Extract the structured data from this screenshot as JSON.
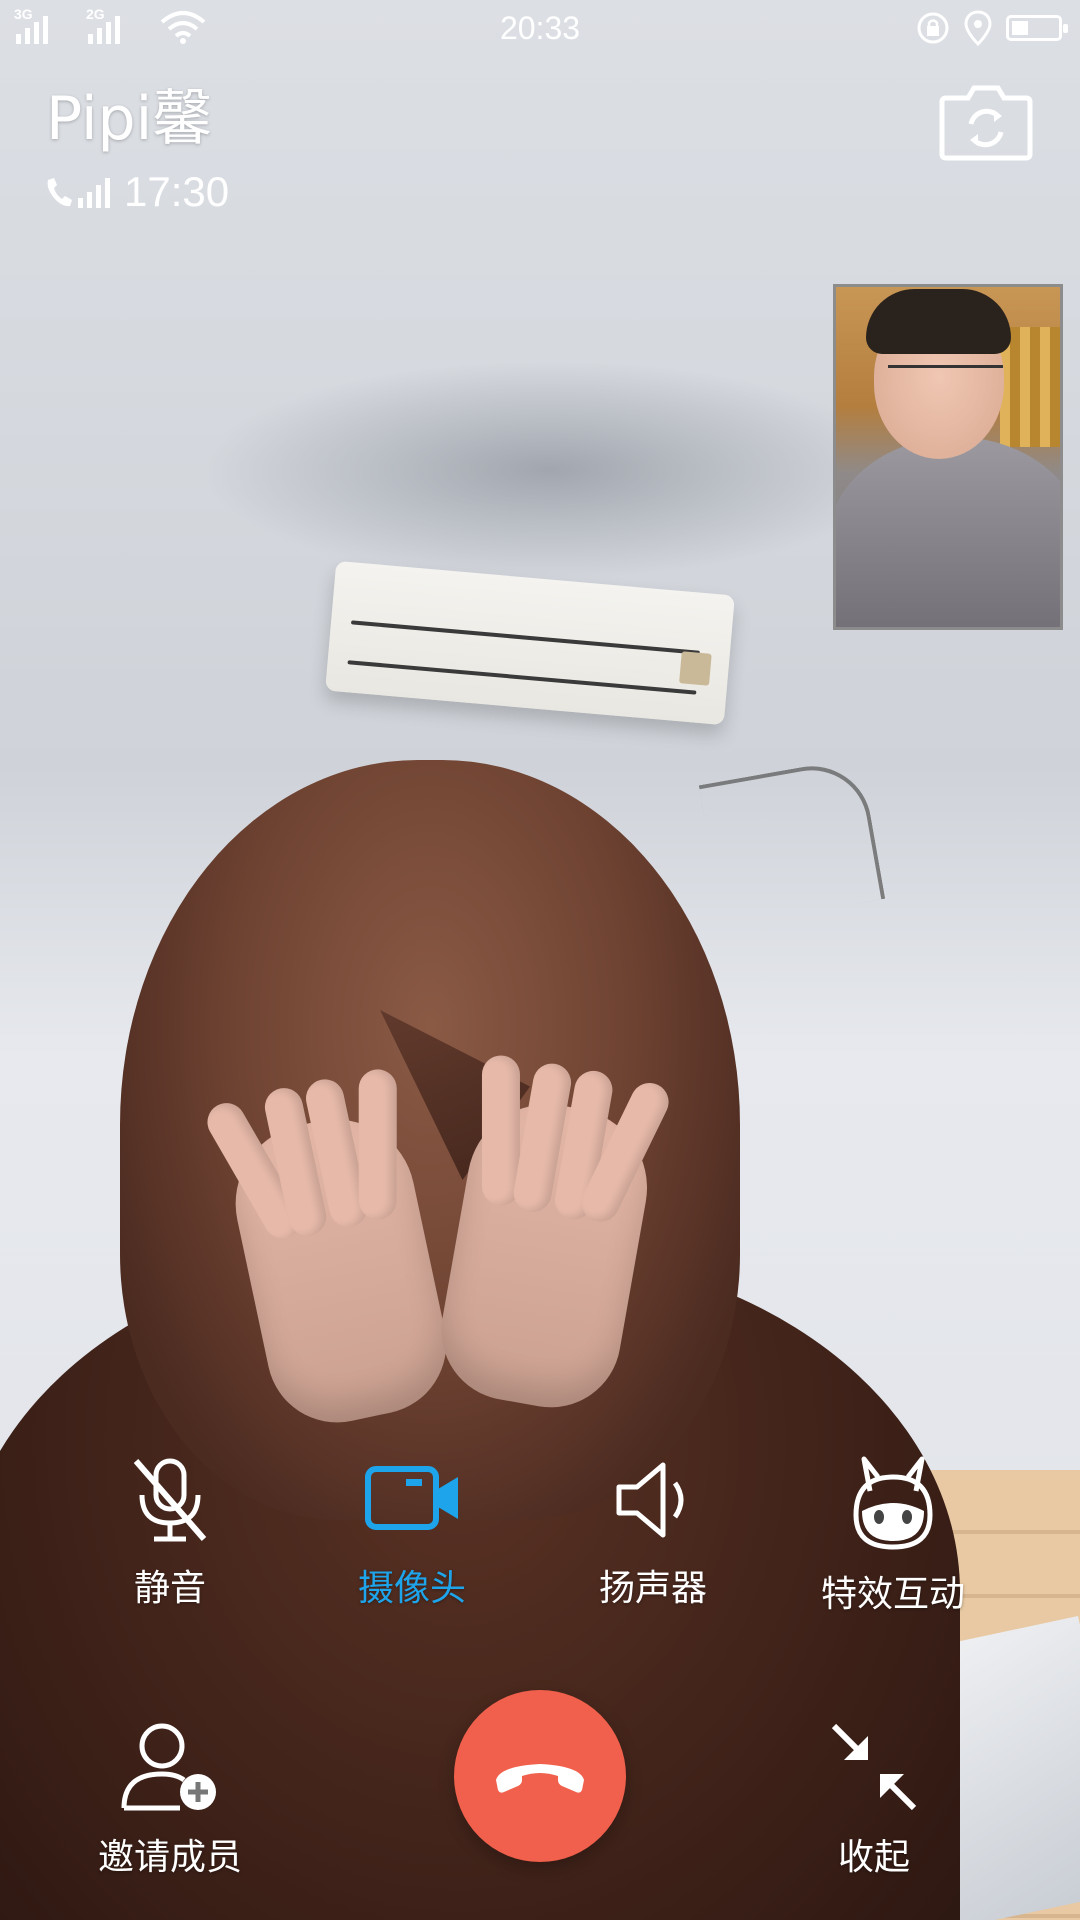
{
  "status_bar": {
    "network_1": "3G",
    "network_2": "2G",
    "time": "20:33"
  },
  "call": {
    "caller_name": "Pipi馨",
    "duration": "17:30"
  },
  "controls": {
    "mute_label": "静音",
    "camera_label": "摄像头",
    "speaker_label": "扬声器",
    "effects_label": "特效互动",
    "invite_label": "邀请成员",
    "collapse_label": "收起"
  },
  "colors": {
    "active_accent": "#1da4ea",
    "hangup": "#f0604c"
  },
  "icons": {
    "mute": "mic-off-icon",
    "camera": "video-camera-icon",
    "speaker": "speaker-icon",
    "effects": "bunny-face-icon",
    "invite": "add-person-icon",
    "collapse": "minimize-arrows-icon",
    "hangup": "phone-hangup-icon",
    "switch_camera": "camera-switch-icon"
  }
}
